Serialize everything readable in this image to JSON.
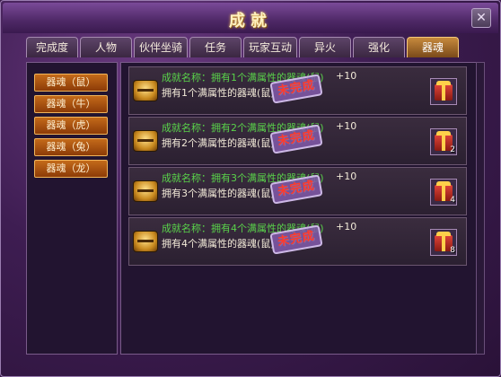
{
  "window": {
    "title": "成就"
  },
  "tabs": [
    {
      "label": "完成度",
      "active": false
    },
    {
      "label": "人物",
      "active": false
    },
    {
      "label": "伙伴坐骑",
      "active": false
    },
    {
      "label": "任务",
      "active": false
    },
    {
      "label": "玩家互动",
      "active": false
    },
    {
      "label": "异火",
      "active": false
    },
    {
      "label": "强化",
      "active": false
    },
    {
      "label": "器魂",
      "active": true
    }
  ],
  "sidebar": {
    "items": [
      {
        "label": "器魂（鼠）"
      },
      {
        "label": "器魂（牛）"
      },
      {
        "label": "器魂（虎）"
      },
      {
        "label": "器魂（兔）"
      },
      {
        "label": "器魂（龙）"
      }
    ]
  },
  "achievements": [
    {
      "name": "成就名称：拥有1个满属性的器魂(鼠)",
      "desc": "拥有1个满属性的器魂(鼠)",
      "points": "+10",
      "status": "未完成",
      "reward_count": ""
    },
    {
      "name": "成就名称：拥有2个满属性的器魂(鼠)",
      "desc": "拥有2个满属性的器魂(鼠)",
      "points": "+10",
      "status": "未完成",
      "reward_count": "2"
    },
    {
      "name": "成就名称：拥有3个满属性的器魂(鼠)",
      "desc": "拥有3个满属性的器魂(鼠)",
      "points": "+10",
      "status": "未完成",
      "reward_count": "4"
    },
    {
      "name": "成就名称：拥有4个满属性的器魂(鼠)",
      "desc": "拥有4个满属性的器魂(鼠)",
      "points": "+10",
      "status": "未完成",
      "reward_count": "8"
    }
  ],
  "icons": {
    "close": "close-icon",
    "chest": "treasure-chest-icon",
    "gift": "gift-box-icon"
  }
}
